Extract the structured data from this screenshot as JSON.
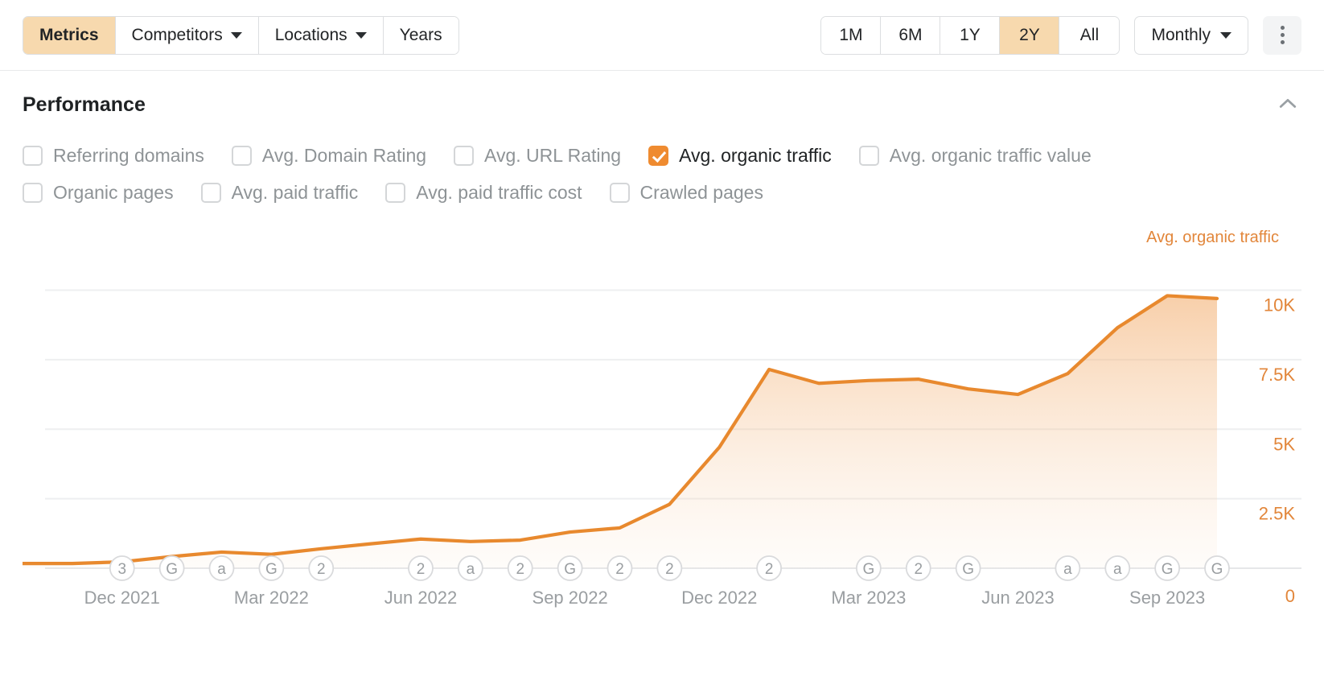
{
  "toolbar": {
    "tabs": [
      {
        "label": "Metrics",
        "active": true,
        "caret": false,
        "name": "tab-metrics"
      },
      {
        "label": "Competitors",
        "active": false,
        "caret": true,
        "name": "tab-competitors"
      },
      {
        "label": "Locations",
        "active": false,
        "caret": true,
        "name": "tab-locations"
      },
      {
        "label": "Years",
        "active": false,
        "caret": false,
        "name": "tab-years"
      }
    ],
    "ranges": [
      {
        "label": "1M",
        "active": false
      },
      {
        "label": "6M",
        "active": false
      },
      {
        "label": "1Y",
        "active": false
      },
      {
        "label": "2Y",
        "active": true
      },
      {
        "label": "All",
        "active": false
      }
    ],
    "granularity": {
      "label": "Monthly",
      "caret_icon": "chevron-down-icon"
    },
    "more_menu": {
      "icon": "kebab-menu-icon"
    }
  },
  "section": {
    "title": "Performance",
    "collapse_icon": "chevron-up-icon",
    "metrics": [
      {
        "label": "Referring domains",
        "checked": false
      },
      {
        "label": "Avg. Domain Rating",
        "checked": false
      },
      {
        "label": "Avg. URL Rating",
        "checked": false
      },
      {
        "label": "Avg. organic traffic",
        "checked": true
      },
      {
        "label": "Avg. organic traffic value",
        "checked": false
      },
      {
        "label": "Organic pages",
        "checked": false
      },
      {
        "label": "Avg. paid traffic",
        "checked": false
      },
      {
        "label": "Avg. paid traffic cost",
        "checked": false
      },
      {
        "label": "Crawled pages",
        "checked": false
      }
    ],
    "metrics_row_split": 5
  },
  "chart_data": {
    "type": "area",
    "title": "",
    "series_name": "Avg. organic traffic",
    "accent_color": "#e8892e",
    "grid": true,
    "legend_position": "top-right",
    "xlabel": "",
    "ylabel": "Avg. organic traffic",
    "ylim": [
      0,
      11000
    ],
    "ytick_labels": [
      "10K",
      "7.5K",
      "5K",
      "2.5K",
      "0"
    ],
    "ytick_values": [
      10000,
      7500,
      5000,
      2500,
      0
    ],
    "xtick_labels": [
      "Dec 2021",
      "Mar 2022",
      "Jun 2022",
      "Sep 2022",
      "Dec 2022",
      "Mar 2023",
      "Jun 2023",
      "Sep 2023"
    ],
    "x": [
      "Oct 2021",
      "Nov 2021",
      "Dec 2021",
      "Jan 2022",
      "Feb 2022",
      "Mar 2022",
      "Apr 2022",
      "May 2022",
      "Jun 2022",
      "Jul 2022",
      "Aug 2022",
      "Sep 2022",
      "Oct 2022",
      "Nov 2022",
      "Dec 2022",
      "Jan 2023",
      "Feb 2023",
      "Mar 2023",
      "Apr 2023",
      "May 2023",
      "Jun 2023",
      "Jul 2023",
      "Aug 2023",
      "Sep 2023",
      "Oct 2023"
    ],
    "values": [
      170,
      170,
      230,
      420,
      580,
      500,
      700,
      880,
      1050,
      960,
      1010,
      1300,
      1450,
      2300,
      4350,
      7150,
      6650,
      6750,
      6800,
      6450,
      6250,
      7000,
      8650,
      9800,
      9700
    ],
    "event_markers": [
      {
        "label": "3",
        "x_index": 2
      },
      {
        "label": "G",
        "x_index": 3
      },
      {
        "label": "a",
        "x_index": 4
      },
      {
        "label": "G",
        "x_index": 5
      },
      {
        "label": "2",
        "x_index": 6
      },
      {
        "label": "2",
        "x_index": 8
      },
      {
        "label": "a",
        "x_index": 9
      },
      {
        "label": "2",
        "x_index": 10
      },
      {
        "label": "G",
        "x_index": 11
      },
      {
        "label": "2",
        "x_index": 12
      },
      {
        "label": "2",
        "x_index": 13
      },
      {
        "label": "2",
        "x_index": 15
      },
      {
        "label": "G",
        "x_index": 17
      },
      {
        "label": "2",
        "x_index": 18
      },
      {
        "label": "G",
        "x_index": 19
      },
      {
        "label": "a",
        "x_index": 21
      },
      {
        "label": "a",
        "x_index": 22
      },
      {
        "label": "G",
        "x_index": 23
      },
      {
        "label": "G",
        "x_index": 24
      }
    ]
  }
}
